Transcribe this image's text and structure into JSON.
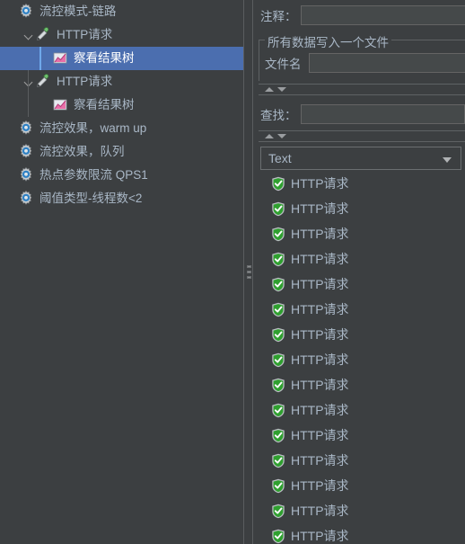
{
  "tree": {
    "items": [
      {
        "label": "流控模式-链路",
        "icon": "gear-icon",
        "depth": 0,
        "expandable": false,
        "selected": false
      },
      {
        "label": "HTTP请求",
        "icon": "pipette-icon",
        "depth": 1,
        "expandable": true,
        "selected": false
      },
      {
        "label": "察看结果树",
        "icon": "chart-icon",
        "depth": 2,
        "expandable": false,
        "selected": true
      },
      {
        "label": "HTTP请求",
        "icon": "pipette-icon",
        "depth": 1,
        "expandable": true,
        "selected": false
      },
      {
        "label": "察看结果树",
        "icon": "chart-icon",
        "depth": 2,
        "expandable": false,
        "selected": false
      },
      {
        "label": "流控效果，warm up",
        "icon": "gear-icon",
        "depth": 0,
        "expandable": false,
        "selected": false
      },
      {
        "label": "流控效果，队列",
        "icon": "gear-icon",
        "depth": 0,
        "expandable": false,
        "selected": false
      },
      {
        "label": "热点参数限流 QPS1",
        "icon": "gear-icon",
        "depth": 0,
        "expandable": false,
        "selected": false
      },
      {
        "label": "阈值类型-线程数<2",
        "icon": "gear-icon",
        "depth": 0,
        "expandable": false,
        "selected": false
      }
    ]
  },
  "splitter": {
    "name": "panel-splitter"
  },
  "right": {
    "comment": {
      "label": "注释：",
      "value": "",
      "placeholder": ""
    },
    "file_group": {
      "title": "所有数据写入一个文件",
      "filename": {
        "label": "文件名",
        "value": "",
        "placeholder": ""
      }
    },
    "search": {
      "label": "查找：",
      "value": "",
      "placeholder": ""
    },
    "render_combo": {
      "value": "Text",
      "options": [
        "Text"
      ]
    },
    "results": [
      {
        "label": "HTTP请求",
        "icon": "shield-check-icon"
      },
      {
        "label": "HTTP请求",
        "icon": "shield-check-icon"
      },
      {
        "label": "HTTP请求",
        "icon": "shield-check-icon"
      },
      {
        "label": "HTTP请求",
        "icon": "shield-check-icon"
      },
      {
        "label": "HTTP请求",
        "icon": "shield-check-icon"
      },
      {
        "label": "HTTP请求",
        "icon": "shield-check-icon"
      },
      {
        "label": "HTTP请求",
        "icon": "shield-check-icon"
      },
      {
        "label": "HTTP请求",
        "icon": "shield-check-icon"
      },
      {
        "label": "HTTP请求",
        "icon": "shield-check-icon"
      },
      {
        "label": "HTTP请求",
        "icon": "shield-check-icon"
      },
      {
        "label": "HTTP请求",
        "icon": "shield-check-icon"
      },
      {
        "label": "HTTP请求",
        "icon": "shield-check-icon"
      },
      {
        "label": "HTTP请求",
        "icon": "shield-check-icon"
      },
      {
        "label": "HTTP请求",
        "icon": "shield-check-icon"
      },
      {
        "label": "HTTP请求",
        "icon": "shield-check-icon"
      }
    ]
  },
  "colors": {
    "background": "#3c3f41",
    "selection": "#4b6eaf",
    "selection_bar": "#6fa8ea",
    "text": "#a9b7c6",
    "field_bg": "#45494a",
    "border": "#5e6264",
    "shield_green": "#36a236",
    "gear_blue": "#4a90d9"
  }
}
